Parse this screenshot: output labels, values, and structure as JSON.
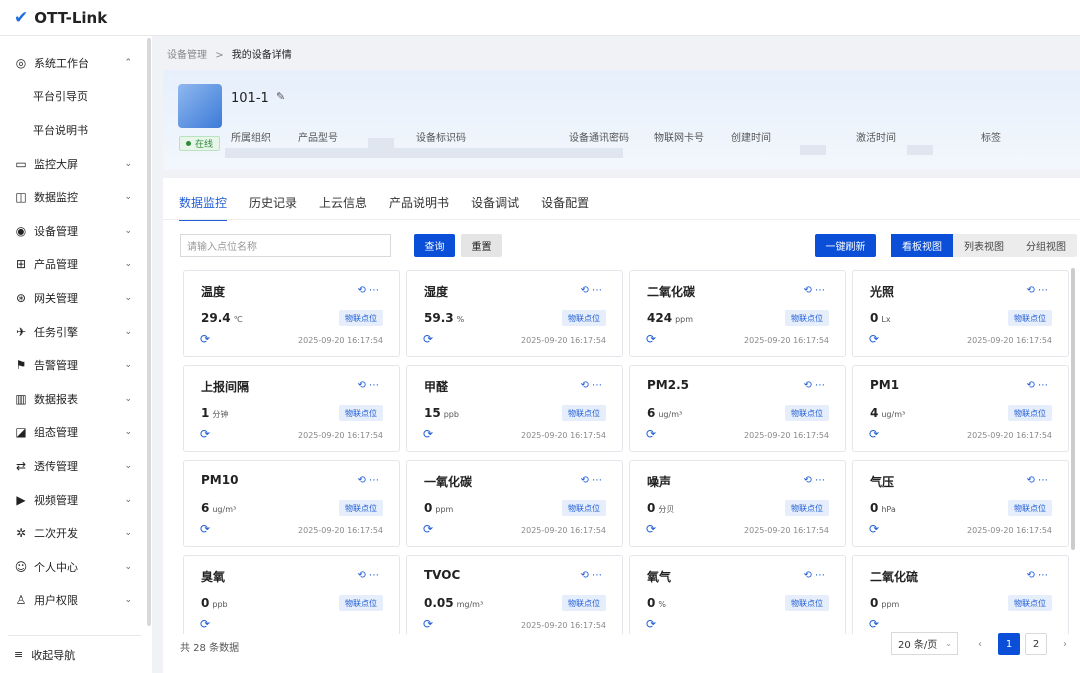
{
  "app": {
    "logo_text": "OTT-Link",
    "logo_icon": "brand-check-icon"
  },
  "sidebar": {
    "items": [
      {
        "label": "系统工作台",
        "icon": "dashboard-icon",
        "glyph": "◎",
        "chev": "⌃"
      },
      {
        "label": "平台引导页",
        "sub": true
      },
      {
        "label": "平台说明书",
        "sub": true
      },
      {
        "label": "监控大屏",
        "icon": "monitor-icon",
        "glyph": "▭",
        "chev": "⌄"
      },
      {
        "label": "数据监控",
        "icon": "chart-icon",
        "glyph": "◫",
        "chev": "⌄"
      },
      {
        "label": "设备管理",
        "icon": "device-icon",
        "glyph": "◉",
        "chev": "⌄"
      },
      {
        "label": "产品管理",
        "icon": "grid-icon",
        "glyph": "⊞",
        "chev": "⌄"
      },
      {
        "label": "网关管理",
        "icon": "gateway-icon",
        "glyph": "⊛",
        "chev": "⌄"
      },
      {
        "label": "任务引擎",
        "icon": "rocket-icon",
        "glyph": "✈",
        "chev": "⌄"
      },
      {
        "label": "告警管理",
        "icon": "alarm-icon",
        "glyph": "⚑",
        "chev": "⌄"
      },
      {
        "label": "数据报表",
        "icon": "report-icon",
        "glyph": "▥",
        "chev": "⌄"
      },
      {
        "label": "组态管理",
        "icon": "config-icon",
        "glyph": "◪",
        "chev": "⌄"
      },
      {
        "label": "透传管理",
        "icon": "transfer-icon",
        "glyph": "⇄",
        "chev": "⌄"
      },
      {
        "label": "视频管理",
        "icon": "video-icon",
        "glyph": "▶",
        "chev": "⌄"
      },
      {
        "label": "二次开发",
        "icon": "bug-icon",
        "glyph": "✲",
        "chev": "⌄"
      },
      {
        "label": "个人中心",
        "icon": "user-icon",
        "glyph": "☺",
        "chev": "⌄"
      },
      {
        "label": "用户权限",
        "icon": "permission-icon",
        "glyph": "♙",
        "chev": "⌄"
      }
    ],
    "collapse_label": "收起导航"
  },
  "breadcrumb": {
    "parent": "设备管理",
    "sep": ">",
    "current": "我的设备详情"
  },
  "device": {
    "name": "101-1",
    "status": "在线",
    "meta_labels": [
      "所属组织",
      "产品型号",
      "设备标识码",
      "设备通讯密码",
      "物联网卡号",
      "创建时间",
      "激活时间",
      "标签"
    ]
  },
  "tabs": [
    "数据监控",
    "历史记录",
    "上云信息",
    "产品说明书",
    "设备调试",
    "设备配置"
  ],
  "toolbar": {
    "search_placeholder": "请输入点位名称",
    "query": "查询",
    "reset": "重置",
    "refresh_all": "一键刷新",
    "views": [
      "看板视图",
      "列表视图",
      "分组视图"
    ]
  },
  "point_tag": "物联点位",
  "cards": [
    {
      "title": "温度",
      "value": "29.4",
      "unit": "℃",
      "time": "2025-09-20 16:17:54"
    },
    {
      "title": "湿度",
      "value": "59.3",
      "unit": "%",
      "time": "2025-09-20 16:17:54"
    },
    {
      "title": "二氧化碳",
      "value": "424",
      "unit": "ppm",
      "time": "2025-09-20 16:17:54"
    },
    {
      "title": "光照",
      "value": "0",
      "unit": "Lx",
      "time": "2025-09-20 16:17:54"
    },
    {
      "title": "上报间隔",
      "value": "1",
      "unit": "分钟",
      "time": "2025-09-20 16:17:54"
    },
    {
      "title": "甲醛",
      "value": "15",
      "unit": "ppb",
      "time": "2025-09-20 16:17:54"
    },
    {
      "title": "PM2.5",
      "value": "6",
      "unit": "ug/m³",
      "time": "2025-09-20 16:17:54"
    },
    {
      "title": "PM1",
      "value": "4",
      "unit": "ug/m³",
      "time": "2025-09-20 16:17:54"
    },
    {
      "title": "PM10",
      "value": "6",
      "unit": "ug/m³",
      "time": "2025-09-20 16:17:54"
    },
    {
      "title": "一氧化碳",
      "value": "0",
      "unit": "ppm",
      "time": "2025-09-20 16:17:54"
    },
    {
      "title": "噪声",
      "value": "0",
      "unit": "分贝",
      "time": "2025-09-20 16:17:54"
    },
    {
      "title": "气压",
      "value": "0",
      "unit": "hPa",
      "time": "2025-09-20 16:17:54"
    },
    {
      "title": "臭氧",
      "value": "0",
      "unit": "ppb",
      "time": ""
    },
    {
      "title": "TVOC",
      "value": "0.05",
      "unit": "mg/m³",
      "time": "2025-09-20 16:17:54"
    },
    {
      "title": "氧气",
      "value": "0",
      "unit": "%",
      "time": ""
    },
    {
      "title": "二氧化硫",
      "value": "0",
      "unit": "ppm",
      "time": ""
    }
  ],
  "pagination": {
    "total": "共 28 条数据",
    "page_size": "20 条/页",
    "pages": [
      "1",
      "2"
    ],
    "current": "1",
    "prev": "‹",
    "next": "›"
  },
  "colors": {
    "primary": "#0b4fd8",
    "online": "#2e8b3a"
  }
}
